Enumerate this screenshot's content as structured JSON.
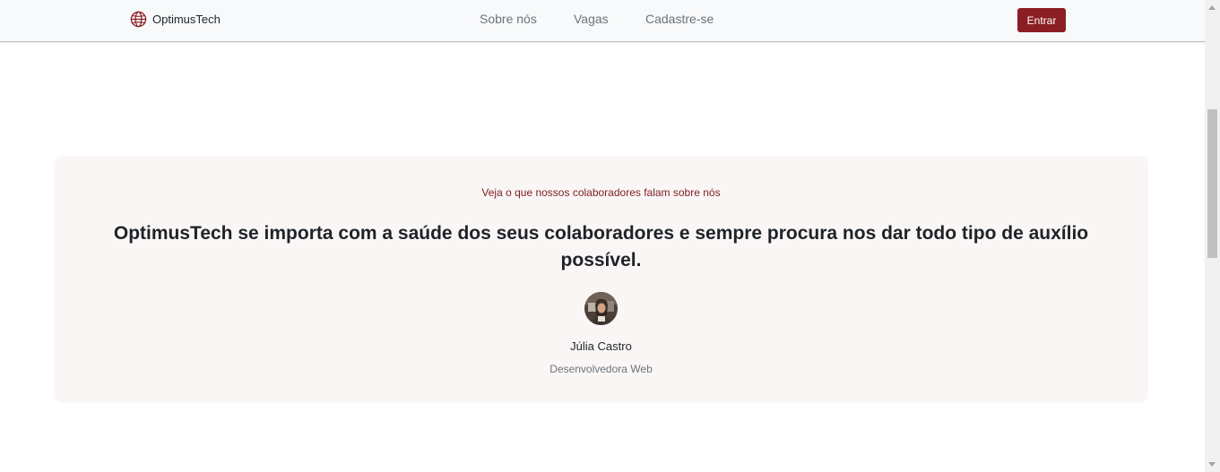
{
  "navbar": {
    "brand_name": "OptimusTech",
    "links": [
      {
        "label": "Sobre nós"
      },
      {
        "label": "Vagas"
      },
      {
        "label": "Cadastre-se"
      }
    ],
    "login_label": "Entrar"
  },
  "testimonial": {
    "kicker": "Veja o que nossos colaboradores falam sobre nós",
    "quote": "OptimusTech se importa com a saúde dos seus colaboradores e sempre procura nos dar todo tipo de auxílio possível.",
    "author_name": "Júlia Castro",
    "author_role": "Desenvolvedora Web"
  },
  "colors": {
    "accent": "#8b1e22",
    "kicker": "#7d1d22",
    "card_bg": "#faf6f6",
    "nav_bg": "#f8f9fa"
  },
  "icons": {
    "brand": "globe-icon",
    "avatar": "avatar-photo"
  }
}
